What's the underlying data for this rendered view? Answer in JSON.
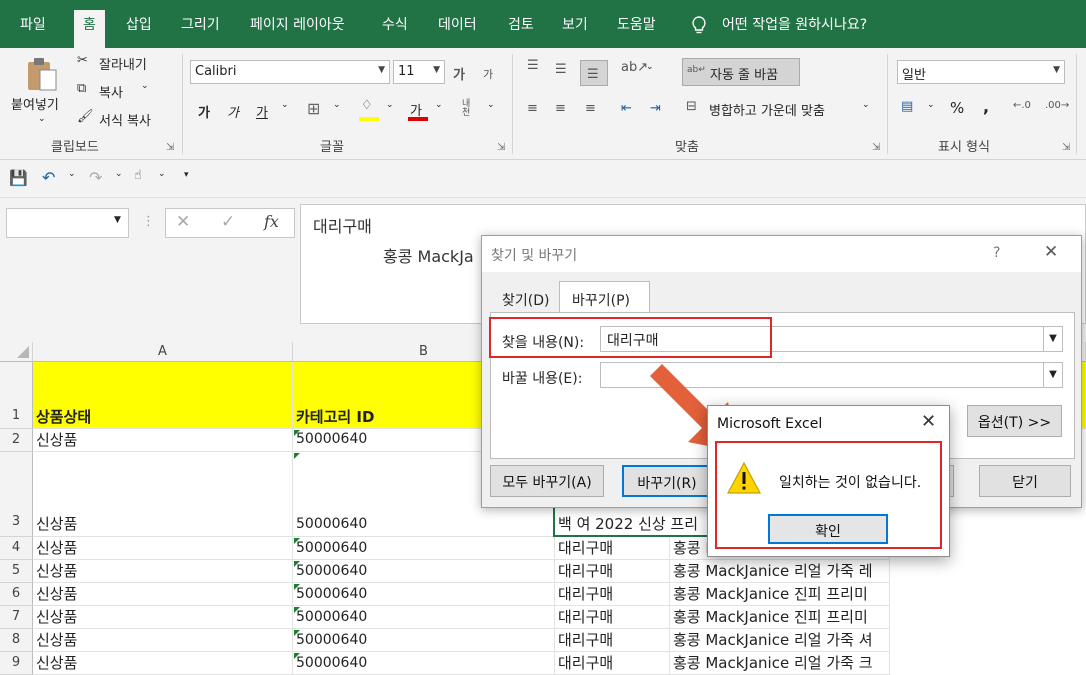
{
  "ribbon_tabs": [
    "파일",
    "홈",
    "삽입",
    "그리기",
    "페이지 레이아웃",
    "수식",
    "데이터",
    "검토",
    "보기",
    "도움말"
  ],
  "tell_me": "어떤 작업을 원하시나요?",
  "clipboard": {
    "paste": "붙여넣기",
    "cut": "잘라내기",
    "copy": "복사",
    "format_painter": "서식 복사",
    "label": "클립보드"
  },
  "font": {
    "name": "Calibri",
    "size": "11",
    "grow": "가",
    "shrink": "가",
    "bold": "가",
    "italic": "가",
    "underline": "가",
    "color": "가",
    "phonetic": "내천",
    "label": "글꼴"
  },
  "alignment": {
    "wrap": "자동 줄 바꿈",
    "merge": "병합하고 가운데 맞춤",
    "label": "맞춤"
  },
  "number": {
    "format": "일반",
    "percent": "%",
    "comma": ",",
    "label": "표시 형식"
  },
  "formula": {
    "fx": "fx",
    "line1": "대리구매",
    "line2": "홍콩 MackJa"
  },
  "grid": {
    "columns": [
      "A",
      "B"
    ],
    "header_row": {
      "num": "1",
      "a": "상품상태",
      "b": "카테고리 ID"
    },
    "rows": [
      {
        "num": "2",
        "a": "신상품",
        "b": "50000640",
        "c": "",
        "d": ""
      },
      {
        "num": "3",
        "a": "신상품",
        "b": "50000640",
        "c": "백 여 2022 신상 프리",
        "d": ""
      },
      {
        "num": "4",
        "a": "신상품",
        "b": "50000640",
        "c": "대리구매",
        "d": "홍콩 MackJanice 리얼 가죽 레"
      },
      {
        "num": "5",
        "a": "신상품",
        "b": "50000640",
        "c": "대리구매",
        "d": "홍콩 MackJanice 리얼 가죽 레"
      },
      {
        "num": "6",
        "a": "신상품",
        "b": "50000640",
        "c": "대리구매",
        "d": "홍콩 MackJanice 진피 프리미"
      },
      {
        "num": "7",
        "a": "신상품",
        "b": "50000640",
        "c": "대리구매",
        "d": "홍콩 MackJanice 진피 프리미"
      },
      {
        "num": "8",
        "a": "신상품",
        "b": "50000640",
        "c": "대리구매",
        "d": "홍콩 MackJanice 리얼 가죽 셔"
      },
      {
        "num": "9",
        "a": "신상품",
        "b": "50000640",
        "c": "대리구매",
        "d": "홍콩 MackJanice 리얼 가죽 크"
      }
    ]
  },
  "find_dialog": {
    "title": "찾기 및 바꾸기",
    "help": "?",
    "tabs": [
      "찾기(D)",
      "바꾸기(P)"
    ],
    "find_label": "찾을 내용(N):",
    "find_value": "대리구매",
    "replace_label": "바꿀 내용(E):",
    "replace_value": "",
    "options": "옵션(T) >>",
    "replace_all": "모두 바꾸기(A)",
    "replace": "바꾸기(R)",
    "close": "닫기"
  },
  "message_box": {
    "title": "Microsoft Excel",
    "message": "일치하는 것이 없습니다.",
    "ok": "확인"
  },
  "colors": {
    "excel_green": "#217346",
    "header_fill": "#ffff00",
    "highlight": "#e0262b",
    "arrow": "#e2603a"
  }
}
